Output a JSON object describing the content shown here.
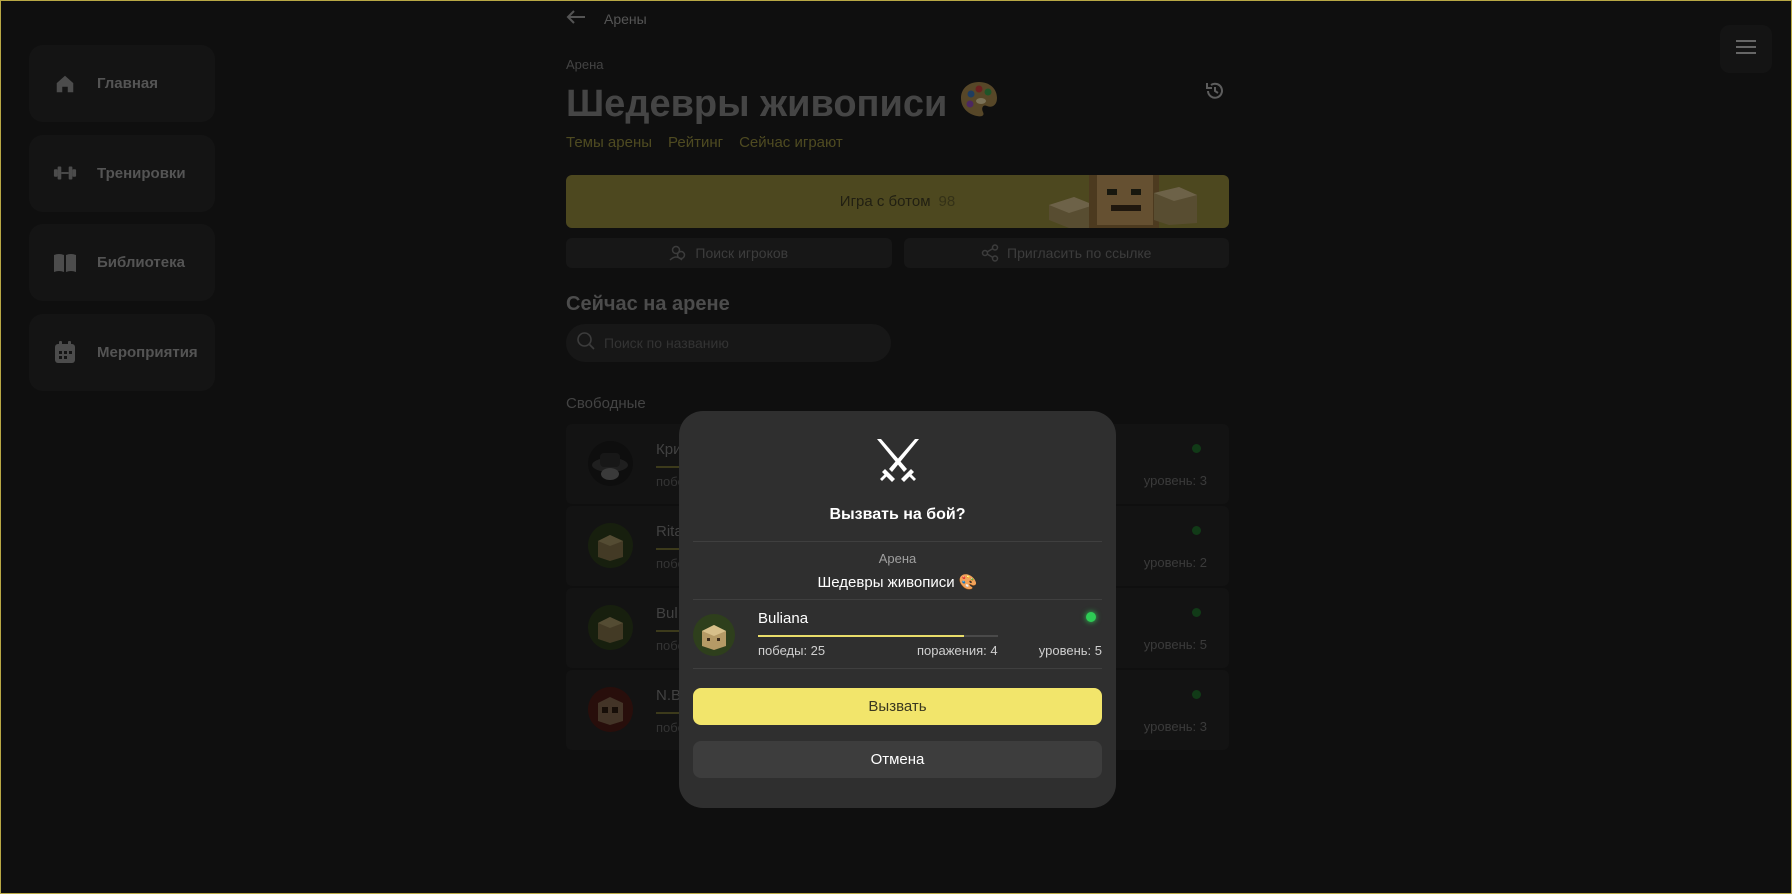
{
  "sidebar": {
    "items": [
      {
        "label": "Главная",
        "icon": "home-icon"
      },
      {
        "label": "Тренировки",
        "icon": "dumbbell-icon"
      },
      {
        "label": "Библиотека",
        "icon": "book-icon"
      },
      {
        "label": "Мероприятия",
        "icon": "calendar-icon"
      }
    ]
  },
  "header": {
    "back_label": "Арены",
    "breadcrumb": "Арена",
    "title": "Шедевры живописи",
    "title_emoji": "🎨"
  },
  "tabs": [
    "Темы арены",
    "Рейтинг",
    "Сейчас играют"
  ],
  "bot_game": {
    "label": "Игра с ботом",
    "count": "98"
  },
  "actions": {
    "find_players": "Поиск игроков",
    "invite_link": "Пригласить по ссылке"
  },
  "section_title": "Сейчас на арене",
  "search": {
    "placeholder": "Поиск по названию"
  },
  "free_label": "Свободные",
  "players": [
    {
      "name": "Кри",
      "wins": "побе",
      "level": "уровень: 3"
    },
    {
      "name": "Rita",
      "wins": "побе",
      "level": "уровень: 2"
    },
    {
      "name": "Bul",
      "wins": "побе",
      "level": "уровень: 5"
    },
    {
      "name": "N.B",
      "wins": "побе",
      "level": "уровень: 3"
    }
  ],
  "modal": {
    "question": "Вызвать на бой?",
    "arena_label": "Арена",
    "arena_name": "Шедевры живописи 🎨",
    "opponent": {
      "name": "Buliana",
      "wins": "победы: 25",
      "losses": "поражения: 4",
      "level": "уровень: 5",
      "win_ratio": 0.86
    },
    "challenge_label": "Вызвать",
    "cancel_label": "Отмена"
  },
  "colors": {
    "accent": "#f2e56b",
    "online": "#2ecc55",
    "background": "#1c1c1c"
  }
}
